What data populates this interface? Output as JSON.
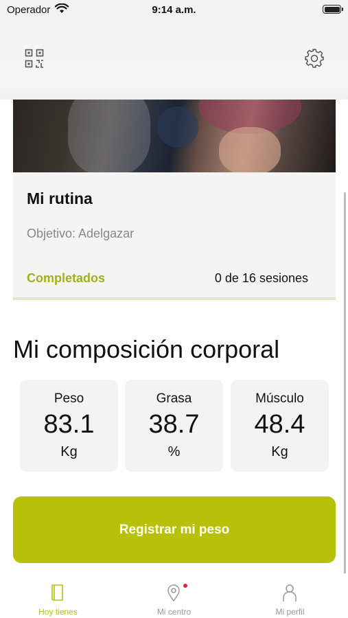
{
  "status_bar": {
    "carrier": "Operador",
    "time": "9:14 a.m.",
    "wifi_icon": "wifi-icon",
    "battery_icon": "battery-icon"
  },
  "header": {
    "left_icon": "qr-code-icon",
    "right_icon": "gear-icon"
  },
  "routine": {
    "title": "Mi rutina",
    "goal": "Objetivo: Adelgazar",
    "completed_label": "Completados",
    "sessions": "0 de 16 sesiones"
  },
  "body_composition": {
    "title": "Mi composición corporal",
    "metrics": [
      {
        "label": "Peso",
        "value": "83.1",
        "unit": "Kg"
      },
      {
        "label": "Grasa",
        "value": "38.7",
        "unit": "%"
      },
      {
        "label": "Músculo",
        "value": "48.4",
        "unit": "Kg"
      }
    ]
  },
  "cta": {
    "label": "Registrar mi peso"
  },
  "tabs": [
    {
      "label": "Hoy tienes",
      "icon": "book-icon",
      "active": true
    },
    {
      "label": "Mi centro",
      "icon": "location-pin-icon",
      "active": false,
      "notification": true
    },
    {
      "label": "Mi perfil",
      "icon": "person-icon",
      "active": false
    }
  ],
  "colors": {
    "accent": "#b8c10a",
    "completed_text": "#9fb21a",
    "notification_dot": "#e0262b",
    "card_background": "#f3f3f1"
  }
}
